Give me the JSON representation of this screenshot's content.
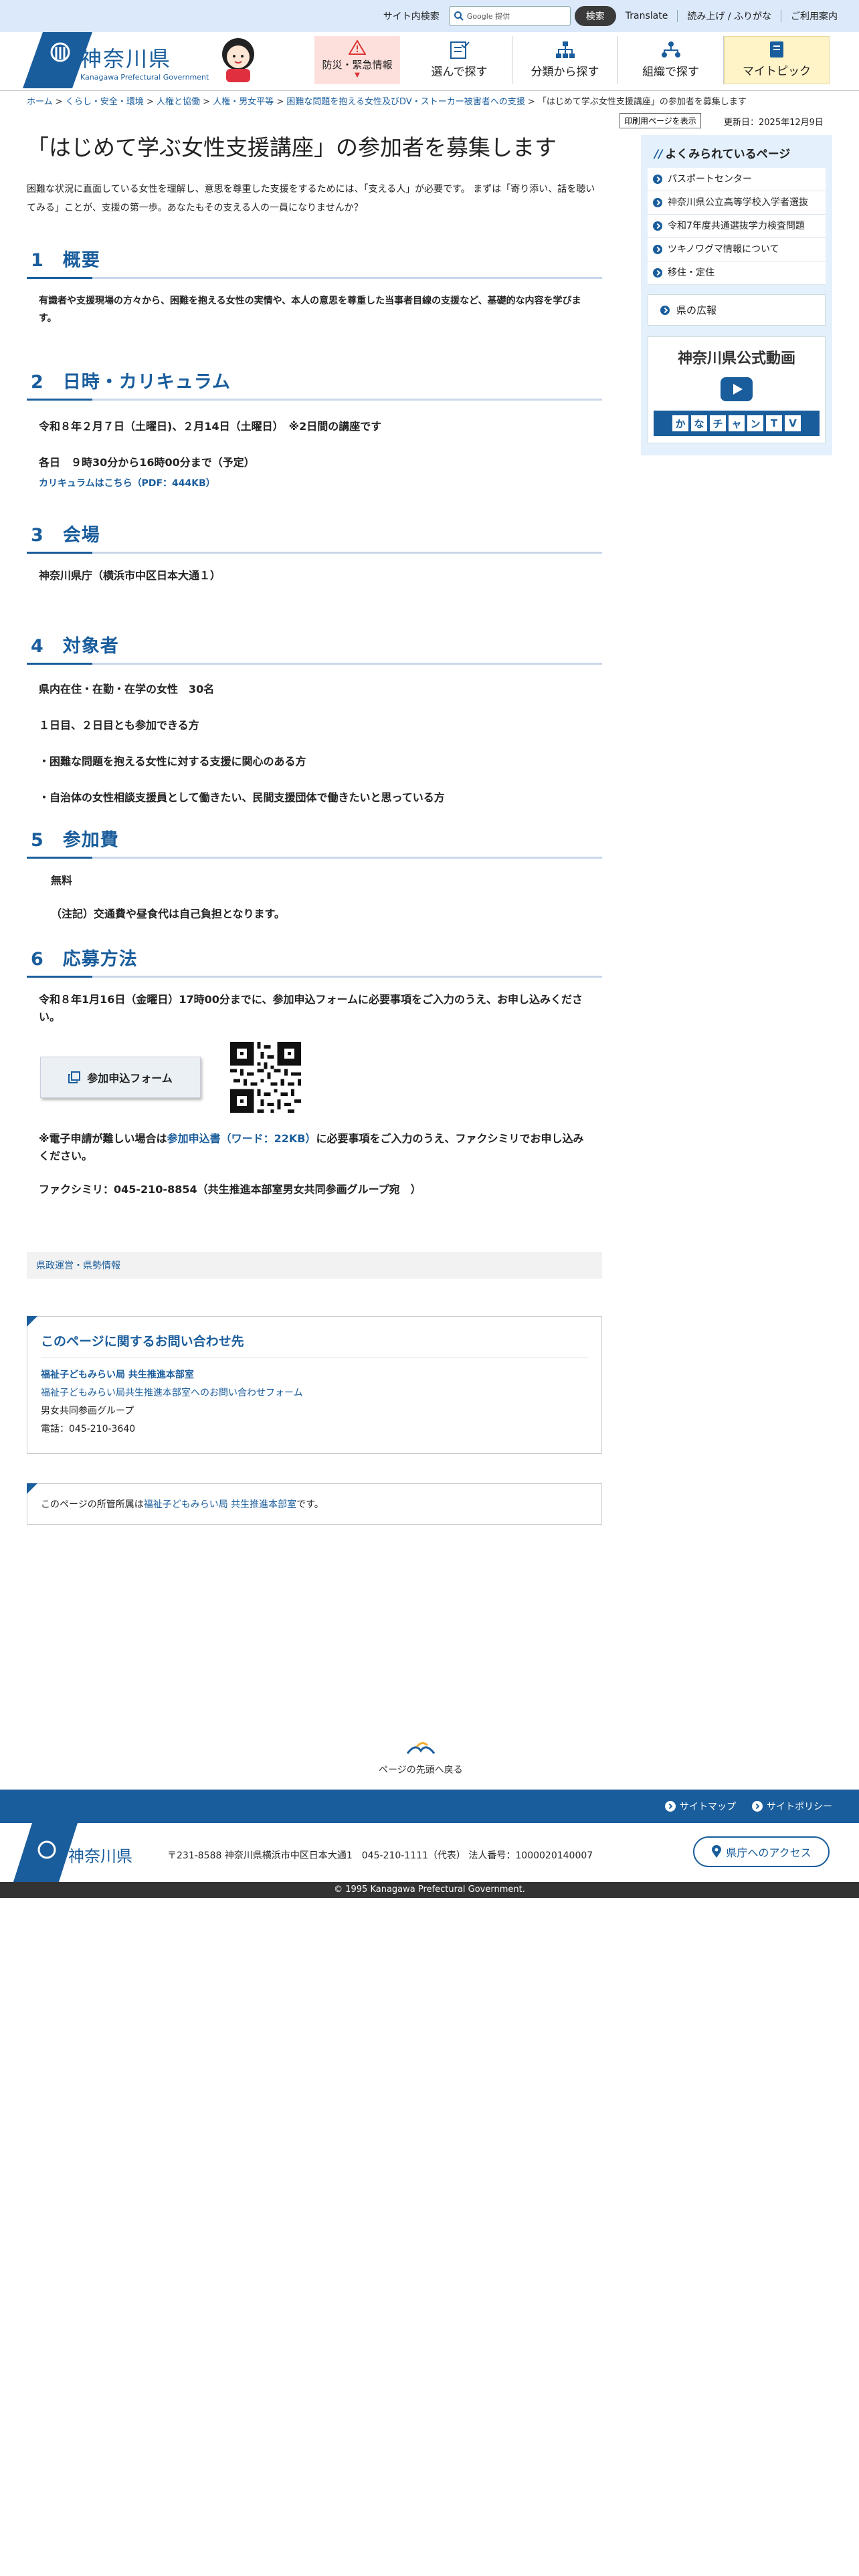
{
  "topbar": {
    "search_label": "サイト内検索",
    "search_placeholder": "Google 提供",
    "search_button": "検索",
    "links": [
      "Translate",
      "読み上げ / ふりがな",
      "ご利用案内"
    ]
  },
  "header": {
    "pref_name": "神奈川県",
    "pref_name_en": "Kanagawa Prefectural Government",
    "logo_small": "KANAGAWA",
    "nav": [
      "防災・緊急情報",
      "選んで探す",
      "分類から探す",
      "組織で探す",
      "マイトピック"
    ]
  },
  "breadcrumb": {
    "items": [
      "ホーム",
      "くらし・安全・環境",
      "人権と協働",
      "人権・男女平等",
      "困難な問題を抱える女性及びDV・ストーカー被害者への支援"
    ],
    "current": "「はじめて学ぶ女性支援講座」の参加者を募集します",
    "sep": ">"
  },
  "print_button": "印刷用ページを表示",
  "updated": "更新日：2025年12月9日",
  "main": {
    "title": "「はじめて学ぶ女性支援講座」の参加者を募集します",
    "lead": "困難な状況に直面している女性を理解し、意思を尊重した支援をするためには、「支える人」が必要です。 まずは「寄り添い、話を聴いてみる」ことが、支援の第一歩。あなたもその支える人の一員になりませんか？",
    "sections": [
      {
        "num": "1",
        "title": "概要",
        "paras": [
          "有識者や支援現場の方々から、困難を抱える女性の実情や、本人の意思を尊重した当事者目線の支援など、基礎的な内容を学びます。"
        ]
      },
      {
        "num": "2",
        "title": "日時・カリキュラム",
        "paras": [
          "令和８年２月７日（土曜日)、２月14日（土曜日）　※2日間の講座です",
          "各日　９時30分から16時00分まで（予定）"
        ],
        "link": "カリキュラムはこちら（PDF：444KB）"
      },
      {
        "num": "3",
        "title": "会場",
        "paras": [
          "神奈川県庁（横浜市中区日本大通１）"
        ]
      },
      {
        "num": "4",
        "title": "対象者",
        "paras": [
          "県内在住・在勤・在学の女性　30名",
          "１日目、２日目とも参加できる方",
          "・困難な問題を抱える女性に対する支援に関心のある方",
          "・自治体の女性相談支援員として働きたい、民間支援団体で働きたいと思っている方"
        ]
      },
      {
        "num": "5",
        "title": "参加費",
        "paras": [
          "無料",
          "（注記）交通費や昼食代は自己負担となります。"
        ]
      },
      {
        "num": "6",
        "title": "応募方法",
        "paras": [
          "令和８年1月16日（金曜日）17時00分までに、参加申込フォームに必要事項をご入力のうえ、お申し込みください。"
        ]
      }
    ],
    "apply_button": "参加申込フォーム",
    "fax_note_pre": "※電子申請が難しい場合は",
    "fax_note_link": "参加申込書（ワード：22KB）",
    "fax_note_post": "に必要事項をご入力のうえ、ファクシミリでお申し込みください。",
    "fax": "ファクシミリ：045-210-8854（共生推進本部室男女共同参画グループ宛　）",
    "category": "県政運営・県勢情報"
  },
  "contact": {
    "title": "このページに関するお問い合わせ先",
    "dept": "福祉子どもみらい局 共生推進本部室",
    "form_link": "福祉子どもみらい局共生推進本部室へのお問い合わせフォーム",
    "group": "男女共同参画グループ",
    "phone": "電話：045-210-3640"
  },
  "owner": {
    "pre": "このページの所管所属は",
    "link": "福祉子どもみらい局 共生推進本部室",
    "post": "です。"
  },
  "sidebar": {
    "title": "よくみられているページ",
    "items": [
      "パスポートセンター",
      "神奈川県公立高等学校入学者選抜",
      "令和7年度共通選抜学力検査問題",
      "ツキノワグマ情報について",
      "移住・定住"
    ],
    "koho": "県の広報",
    "video_title": "神奈川県公式動画",
    "kana_tv": [
      "か",
      "な",
      "チ",
      "ャ",
      "ン",
      "T",
      "V"
    ]
  },
  "pagetop": "ページの先頭へ戻る",
  "footer": {
    "links": [
      "サイトマップ",
      "サイトポリシー"
    ],
    "pref_name": "神奈川県",
    "address": "〒231-8588 神奈川県横浜市中区日本大通1　045-210-1111（代表）  法人番号：1000020140007",
    "access": "県庁へのアクセス",
    "copyright": "© 1995 Kanagawa Prefectural Government."
  },
  "colors": {
    "primary": "#1a5d9c",
    "topbar": "#dbe9fb",
    "sidebar": "#e4f0fb",
    "emergency": "#fde0dc",
    "mytopic": "#fff3c8"
  }
}
